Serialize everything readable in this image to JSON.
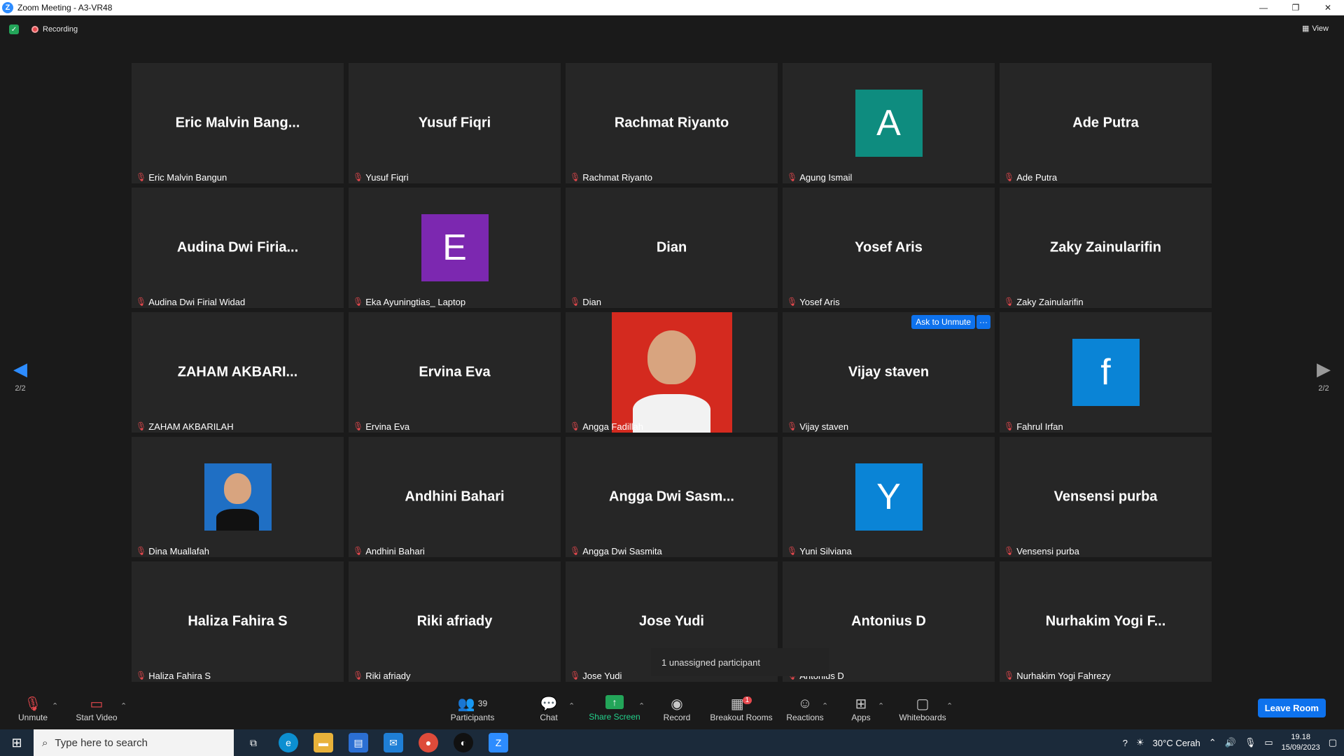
{
  "window": {
    "title": "Zoom Meeting - A3-VR48",
    "minimize": "—",
    "restore": "❐",
    "close": "✕"
  },
  "topbar": {
    "recording_label": "Recording",
    "view_label": "View"
  },
  "tiles": [
    {
      "big": "Eric Malvin Bang...",
      "name": "Eric Malvin Bangun"
    },
    {
      "big": "Yusuf Fiqri",
      "name": "Yusuf Fiqri"
    },
    {
      "big": "Rachmat Riyanto",
      "name": "Rachmat Riyanto"
    },
    {
      "avatar_letter": "A",
      "avatar_color": "#0e8c7f",
      "name": "Agung Ismail"
    },
    {
      "big": "Ade Putra",
      "name": "Ade Putra"
    },
    {
      "big": "Audina Dwi Firia...",
      "name": "Audina Dwi Firial Widad"
    },
    {
      "avatar_letter": "E",
      "avatar_color": "#7c28b0",
      "name": "Eka Ayuningtias_ Laptop"
    },
    {
      "big": "Dian",
      "name": "Dian"
    },
    {
      "big": "Yosef Aris",
      "name": "Yosef Aris"
    },
    {
      "big": "Zaky Zainularifin",
      "name": "Zaky Zainularifin"
    },
    {
      "big": "ZAHAM AKBARI...",
      "name": "ZAHAM AKBARILAH"
    },
    {
      "big": "Ervina Eva",
      "name": "Ervina Eva"
    },
    {
      "photo": "red",
      "name": "Angga Fadillah"
    },
    {
      "big": "Vijay staven",
      "name": "Vijay staven",
      "ask_unmute": "Ask to Unmute",
      "more": "···"
    },
    {
      "avatar_letter": "f",
      "avatar_color": "#0a84d6",
      "name": "Fahrul Irfan"
    },
    {
      "photo": "blue",
      "name": "Dina Muallafah"
    },
    {
      "big": "Andhini Bahari",
      "name": "Andhini Bahari"
    },
    {
      "big": "Angga Dwi Sasm...",
      "name": "Angga Dwi Sasmita"
    },
    {
      "avatar_letter": "Y",
      "avatar_color": "#0a84d6",
      "name": "Yuni Silviana"
    },
    {
      "big": "Vensensi purba",
      "name": "Vensensi purba"
    },
    {
      "big": "Haliza Fahira S",
      "name": "Haliza Fahira S"
    },
    {
      "big": "Riki afriady",
      "name": "Riki afriady"
    },
    {
      "big": "Jose Yudi",
      "name": "Jose Yudi"
    },
    {
      "big": "Antonius D",
      "name": "Antonius D"
    },
    {
      "big": "Nurhakim Yogi F...",
      "name": "Nurhakim Yogi Fahrezy"
    }
  ],
  "pager": {
    "left": "2/2",
    "right": "2/2"
  },
  "tooltip": "1 unassigned participant",
  "toolbar": {
    "unmute": "Unmute",
    "start_video": "Start Video",
    "participants": "Participants",
    "participants_count": "39",
    "chat": "Chat",
    "share_screen": "Share Screen",
    "record": "Record",
    "breakout_rooms": "Breakout Rooms",
    "breakout_badge": "1",
    "reactions": "Reactions",
    "apps": "Apps",
    "whiteboards": "Whiteboards",
    "leave": "Leave Room"
  },
  "taskbar": {
    "search_placeholder": "Type here to search",
    "weather": "30°C  Cerah",
    "time": "19.18",
    "date": "15/09/2023"
  },
  "colors": {
    "accent": "#0e72ed",
    "muted": "#e5484d",
    "green": "#23a559"
  }
}
